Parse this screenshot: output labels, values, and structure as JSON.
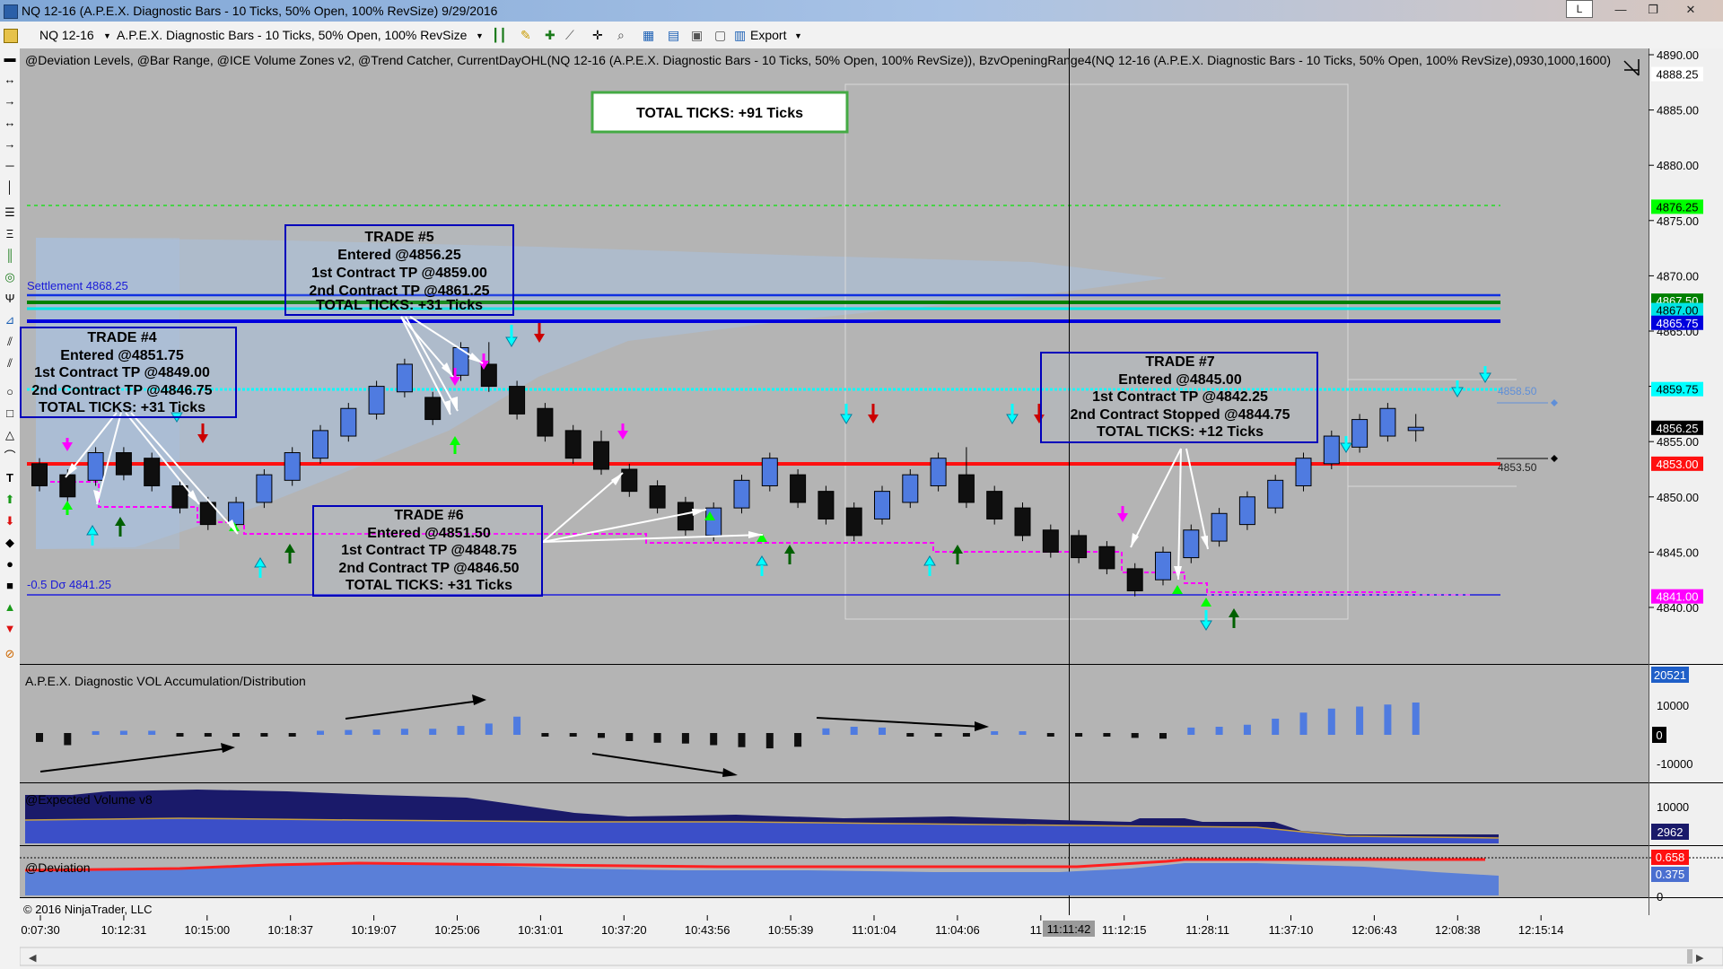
{
  "window": {
    "title": "NQ 12-16 (A.P.E.X. Diagnostic Bars - 10 Ticks, 50% Open, 100% RevSize)  9/29/2016",
    "layout_btn": "L",
    "minimize": "—",
    "restore": "❐",
    "close": "✕"
  },
  "toolbar": {
    "instrument": "NQ 12-16",
    "bar_type": "A.P.E.X. Diagnostic Bars - 10 Ticks, 50% Open, 100% RevSize",
    "export_label": "Export"
  },
  "colors": {
    "panel_bg": "#b4b4b4",
    "bull": "#4f7be0",
    "bear": "#0f0f0f",
    "red_line": "#ff1010",
    "cyan_line": "#00ffff",
    "blue_line": "#0000cc",
    "green_line": "#008000",
    "magenta": "#ff00ff",
    "box_border": "#0000bb"
  },
  "indicators_label": "@Deviation Levels, @Bar Range, @ICE Volume Zones v2, @Trend Catcher, CurrentDayOHL(NQ 12-16 (A.P.E.X. Diagnostic Bars - 10 Ticks, 50% Open, 100% RevSize)), BzvOpeningRange4(NQ 12-16 (A.P.E.X. Diagnostic Bars - 10 Ticks, 50% Open, 100% RevSize),0930,1000,1600)",
  "total_ticks": "TOTAL TICKS: +91 Ticks",
  "trade_boxes": [
    {
      "lines": [
        "TRADE #5",
        "Entered @4856.25",
        "1st Contract TP @4859.00",
        "2nd Contract TP @4861.25",
        "TOTAL TICKS: +31 Ticks"
      ]
    },
    {
      "lines": [
        "TRADE #4",
        "Entered @4851.75",
        "1st Contract TP @4849.00",
        "2nd Contract TP @4846.75",
        "TOTAL TICKS: +31 Ticks"
      ]
    },
    {
      "lines": [
        "TRADE #6",
        "Entered @4851.50",
        "1st Contract TP @4848.75",
        "2nd Contract TP @4846.50",
        "TOTAL TICKS: +31 Ticks"
      ]
    },
    {
      "lines": [
        "TRADE #7",
        "Entered @4845.00",
        "1st Contract TP @4842.25",
        "2nd Contract Stopped @4844.75",
        "TOTAL TICKS: +12 Ticks"
      ]
    }
  ],
  "annotations": {
    "settlement": "Settlement 4868.25",
    "dev_low": "-0.5 Dσ 4841.25",
    "ref_high": "4858.50",
    "ref_low": "4853.50"
  },
  "price_axis": {
    "ticks": [
      "4890.00",
      "4885.00",
      "4880.00",
      "4875.00",
      "4870.00",
      "4865.00",
      "4860.00",
      "4855.00",
      "4850.00",
      "4845.00",
      "4840.00"
    ],
    "markers": [
      {
        "label": "4888.25",
        "price": 4888.25,
        "bg": "#ffffff",
        "fg": "#000000"
      },
      {
        "label": "4876.25",
        "price": 4876.25,
        "bg": "#00ff00",
        "fg": "#000000"
      },
      {
        "label": "4867.50",
        "price": 4867.75,
        "bg": "#008000",
        "fg": "#ffffff"
      },
      {
        "label": "4867.00",
        "price": 4866.9,
        "bg": "#00e5e5",
        "fg": "#000000"
      },
      {
        "label": "4865.75",
        "price": 4865.75,
        "bg": "#0000dd",
        "fg": "#ffffff"
      },
      {
        "label": "4859.75",
        "price": 4859.75,
        "bg": "#00ffff",
        "fg": "#000000"
      },
      {
        "label": "4856.25",
        "price": 4856.25,
        "bg": "#000000",
        "fg": "#ffffff"
      },
      {
        "label": "4853.00",
        "price": 4853.0,
        "bg": "#ff1010",
        "fg": "#ffffff"
      },
      {
        "label": "4841.00",
        "price": 4841.0,
        "bg": "#ff00ff",
        "fg": "#ffffff"
      }
    ]
  },
  "time_axis": [
    "0:07:30",
    "10:12:31",
    "10:15:00",
    "10:18:37",
    "10:19:07",
    "10:25:06",
    "10:31:01",
    "10:37:20",
    "10:43:56",
    "10:55:39",
    "11:01:04",
    "11:04:06",
    "11:1",
    "11:12:15",
    "11:28:11",
    "11:37:10",
    "12:06:43",
    "12:08:38",
    "12:15:14"
  ],
  "crosshair_time": "11:11:42",
  "panels": {
    "vol_title": "A.P.E.X. Diagnostic VOL Accumulation/Distribution",
    "vol_axis": [
      "10000",
      "-10000"
    ],
    "vol_zero": "0",
    "vol_value": "20521",
    "ev_title": "@Expected Volume v8",
    "ev_axis": "10000",
    "ev_value": "2962",
    "dev_title": "@Deviation",
    "dev_value1": "0.658",
    "dev_value2": "0.375",
    "dev_zero": "0"
  },
  "copyright": "© 2016 NinjaTrader, LLC",
  "chart_data": {
    "type": "candlestick",
    "ylim": [
      4838,
      4892
    ],
    "candles": [
      [
        4853,
        4851,
        4853.5,
        4850.5
      ],
      [
        4852,
        4850,
        4852.5,
        4849.5
      ],
      [
        4851.5,
        4854,
        4854.5,
        4851
      ],
      [
        4854,
        4852,
        4854.5,
        4851.5
      ],
      [
        4853.5,
        4851,
        4854,
        4850.5
      ],
      [
        4851,
        4849,
        4851.5,
        4848.5
      ],
      [
        4849.5,
        4847.5,
        4850,
        4847
      ],
      [
        4847.5,
        4849.5,
        4850,
        4847
      ],
      [
        4849.5,
        4852,
        4852.5,
        4849
      ],
      [
        4851.5,
        4854,
        4854.5,
        4851
      ],
      [
        4853.5,
        4856,
        4856.5,
        4853
      ],
      [
        4855.5,
        4858,
        4858.5,
        4855
      ],
      [
        4857.5,
        4860,
        4860.5,
        4857
      ],
      [
        4859.5,
        4862,
        4862.5,
        4859
      ],
      [
        4859,
        4857,
        4859.5,
        4856.5
      ],
      [
        4861,
        4863.5,
        4864,
        4860.5
      ],
      [
        4862,
        4860,
        4864,
        4859.5
      ],
      [
        4860,
        4857.5,
        4860.5,
        4857
      ],
      [
        4858,
        4855.5,
        4858.5,
        4855
      ],
      [
        4856,
        4853.5,
        4856.5,
        4853
      ],
      [
        4855,
        4852.5,
        4856,
        4852
      ],
      [
        4852.5,
        4850.5,
        4853,
        4850
      ],
      [
        4851,
        4849,
        4851.5,
        4848.5
      ],
      [
        4849.5,
        4847,
        4850,
        4846.5
      ],
      [
        4846.5,
        4849,
        4849.5,
        4846
      ],
      [
        4849,
        4851.5,
        4852,
        4848.5
      ],
      [
        4851,
        4853.5,
        4854,
        4850.5
      ],
      [
        4852,
        4849.5,
        4852.5,
        4849
      ],
      [
        4850.5,
        4848,
        4851,
        4847.5
      ],
      [
        4849,
        4846.5,
        4849.5,
        4846
      ],
      [
        4848,
        4850.5,
        4851,
        4847.5
      ],
      [
        4849.5,
        4852,
        4852.5,
        4849
      ],
      [
        4851,
        4853.5,
        4854,
        4850.5
      ],
      [
        4852,
        4849.5,
        4854.5,
        4849
      ],
      [
        4850.5,
        4848,
        4851,
        4847.5
      ],
      [
        4849,
        4846.5,
        4849.5,
        4846
      ],
      [
        4847,
        4845,
        4847.5,
        4844.5
      ],
      [
        4846.5,
        4844.5,
        4847,
        4844
      ],
      [
        4845.5,
        4843.5,
        4846,
        4843
      ],
      [
        4843.5,
        4841.5,
        4844,
        4841
      ],
      [
        4842.5,
        4845,
        4845.5,
        4842
      ],
      [
        4844.5,
        4847,
        4847.5,
        4844
      ],
      [
        4846,
        4848.5,
        4849,
        4845.5
      ],
      [
        4847.5,
        4850,
        4850.5,
        4847
      ],
      [
        4849,
        4851.5,
        4852,
        4848.5
      ],
      [
        4851,
        4853.5,
        4854,
        4850.5
      ],
      [
        4853,
        4855.5,
        4856,
        4852.5
      ],
      [
        4854.5,
        4857,
        4857.5,
        4854
      ],
      [
        4855.5,
        4858,
        4858.5,
        4855
      ],
      [
        4856,
        4856.3,
        4857.5,
        4855
      ]
    ],
    "vol_bars": [
      -2200,
      -3000,
      900,
      1000,
      1000,
      -800,
      -800,
      -800,
      -800,
      -800,
      1000,
      1200,
      1300,
      1500,
      1500,
      2200,
      2800,
      4500,
      -800,
      -800,
      -1200,
      -2000,
      -2400,
      -2600,
      -3000,
      -3500,
      -3800,
      -3400,
      1600,
      2000,
      1800,
      -800,
      -800,
      -800,
      600,
      600,
      -800,
      -800,
      -800,
      -1200,
      -1400,
      1800,
      2000,
      2500,
      4000,
      5500,
      6500,
      7000,
      7500,
      8000
    ]
  }
}
